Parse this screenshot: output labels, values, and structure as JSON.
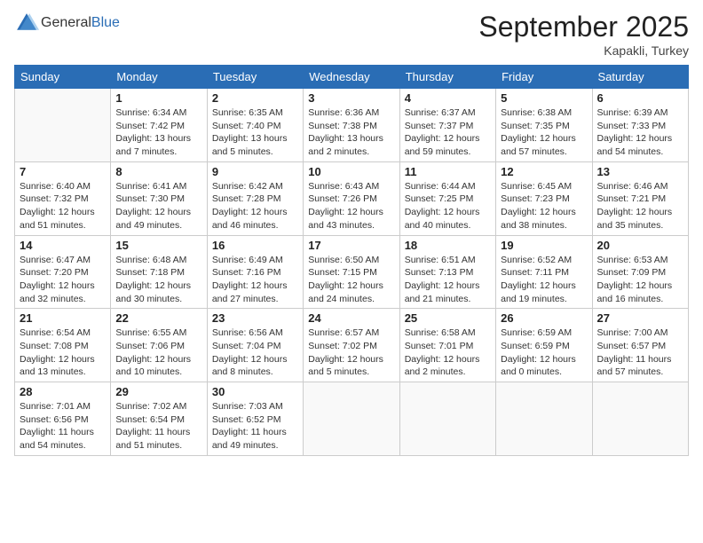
{
  "header": {
    "logo_general": "General",
    "logo_blue": "Blue",
    "month_title": "September 2025",
    "location": "Kapakli, Turkey"
  },
  "days_of_week": [
    "Sunday",
    "Monday",
    "Tuesday",
    "Wednesday",
    "Thursday",
    "Friday",
    "Saturday"
  ],
  "weeks": [
    [
      {
        "day": "",
        "sunrise": "",
        "sunset": "",
        "daylight": ""
      },
      {
        "day": "1",
        "sunrise": "Sunrise: 6:34 AM",
        "sunset": "Sunset: 7:42 PM",
        "daylight": "Daylight: 13 hours and 7 minutes."
      },
      {
        "day": "2",
        "sunrise": "Sunrise: 6:35 AM",
        "sunset": "Sunset: 7:40 PM",
        "daylight": "Daylight: 13 hours and 5 minutes."
      },
      {
        "day": "3",
        "sunrise": "Sunrise: 6:36 AM",
        "sunset": "Sunset: 7:38 PM",
        "daylight": "Daylight: 13 hours and 2 minutes."
      },
      {
        "day": "4",
        "sunrise": "Sunrise: 6:37 AM",
        "sunset": "Sunset: 7:37 PM",
        "daylight": "Daylight: 12 hours and 59 minutes."
      },
      {
        "day": "5",
        "sunrise": "Sunrise: 6:38 AM",
        "sunset": "Sunset: 7:35 PM",
        "daylight": "Daylight: 12 hours and 57 minutes."
      },
      {
        "day": "6",
        "sunrise": "Sunrise: 6:39 AM",
        "sunset": "Sunset: 7:33 PM",
        "daylight": "Daylight: 12 hours and 54 minutes."
      }
    ],
    [
      {
        "day": "7",
        "sunrise": "Sunrise: 6:40 AM",
        "sunset": "Sunset: 7:32 PM",
        "daylight": "Daylight: 12 hours and 51 minutes."
      },
      {
        "day": "8",
        "sunrise": "Sunrise: 6:41 AM",
        "sunset": "Sunset: 7:30 PM",
        "daylight": "Daylight: 12 hours and 49 minutes."
      },
      {
        "day": "9",
        "sunrise": "Sunrise: 6:42 AM",
        "sunset": "Sunset: 7:28 PM",
        "daylight": "Daylight: 12 hours and 46 minutes."
      },
      {
        "day": "10",
        "sunrise": "Sunrise: 6:43 AM",
        "sunset": "Sunset: 7:26 PM",
        "daylight": "Daylight: 12 hours and 43 minutes."
      },
      {
        "day": "11",
        "sunrise": "Sunrise: 6:44 AM",
        "sunset": "Sunset: 7:25 PM",
        "daylight": "Daylight: 12 hours and 40 minutes."
      },
      {
        "day": "12",
        "sunrise": "Sunrise: 6:45 AM",
        "sunset": "Sunset: 7:23 PM",
        "daylight": "Daylight: 12 hours and 38 minutes."
      },
      {
        "day": "13",
        "sunrise": "Sunrise: 6:46 AM",
        "sunset": "Sunset: 7:21 PM",
        "daylight": "Daylight: 12 hours and 35 minutes."
      }
    ],
    [
      {
        "day": "14",
        "sunrise": "Sunrise: 6:47 AM",
        "sunset": "Sunset: 7:20 PM",
        "daylight": "Daylight: 12 hours and 32 minutes."
      },
      {
        "day": "15",
        "sunrise": "Sunrise: 6:48 AM",
        "sunset": "Sunset: 7:18 PM",
        "daylight": "Daylight: 12 hours and 30 minutes."
      },
      {
        "day": "16",
        "sunrise": "Sunrise: 6:49 AM",
        "sunset": "Sunset: 7:16 PM",
        "daylight": "Daylight: 12 hours and 27 minutes."
      },
      {
        "day": "17",
        "sunrise": "Sunrise: 6:50 AM",
        "sunset": "Sunset: 7:15 PM",
        "daylight": "Daylight: 12 hours and 24 minutes."
      },
      {
        "day": "18",
        "sunrise": "Sunrise: 6:51 AM",
        "sunset": "Sunset: 7:13 PM",
        "daylight": "Daylight: 12 hours and 21 minutes."
      },
      {
        "day": "19",
        "sunrise": "Sunrise: 6:52 AM",
        "sunset": "Sunset: 7:11 PM",
        "daylight": "Daylight: 12 hours and 19 minutes."
      },
      {
        "day": "20",
        "sunrise": "Sunrise: 6:53 AM",
        "sunset": "Sunset: 7:09 PM",
        "daylight": "Daylight: 12 hours and 16 minutes."
      }
    ],
    [
      {
        "day": "21",
        "sunrise": "Sunrise: 6:54 AM",
        "sunset": "Sunset: 7:08 PM",
        "daylight": "Daylight: 12 hours and 13 minutes."
      },
      {
        "day": "22",
        "sunrise": "Sunrise: 6:55 AM",
        "sunset": "Sunset: 7:06 PM",
        "daylight": "Daylight: 12 hours and 10 minutes."
      },
      {
        "day": "23",
        "sunrise": "Sunrise: 6:56 AM",
        "sunset": "Sunset: 7:04 PM",
        "daylight": "Daylight: 12 hours and 8 minutes."
      },
      {
        "day": "24",
        "sunrise": "Sunrise: 6:57 AM",
        "sunset": "Sunset: 7:02 PM",
        "daylight": "Daylight: 12 hours and 5 minutes."
      },
      {
        "day": "25",
        "sunrise": "Sunrise: 6:58 AM",
        "sunset": "Sunset: 7:01 PM",
        "daylight": "Daylight: 12 hours and 2 minutes."
      },
      {
        "day": "26",
        "sunrise": "Sunrise: 6:59 AM",
        "sunset": "Sunset: 6:59 PM",
        "daylight": "Daylight: 12 hours and 0 minutes."
      },
      {
        "day": "27",
        "sunrise": "Sunrise: 7:00 AM",
        "sunset": "Sunset: 6:57 PM",
        "daylight": "Daylight: 11 hours and 57 minutes."
      }
    ],
    [
      {
        "day": "28",
        "sunrise": "Sunrise: 7:01 AM",
        "sunset": "Sunset: 6:56 PM",
        "daylight": "Daylight: 11 hours and 54 minutes."
      },
      {
        "day": "29",
        "sunrise": "Sunrise: 7:02 AM",
        "sunset": "Sunset: 6:54 PM",
        "daylight": "Daylight: 11 hours and 51 minutes."
      },
      {
        "day": "30",
        "sunrise": "Sunrise: 7:03 AM",
        "sunset": "Sunset: 6:52 PM",
        "daylight": "Daylight: 11 hours and 49 minutes."
      },
      {
        "day": "",
        "sunrise": "",
        "sunset": "",
        "daylight": ""
      },
      {
        "day": "",
        "sunrise": "",
        "sunset": "",
        "daylight": ""
      },
      {
        "day": "",
        "sunrise": "",
        "sunset": "",
        "daylight": ""
      },
      {
        "day": "",
        "sunrise": "",
        "sunset": "",
        "daylight": ""
      }
    ]
  ]
}
